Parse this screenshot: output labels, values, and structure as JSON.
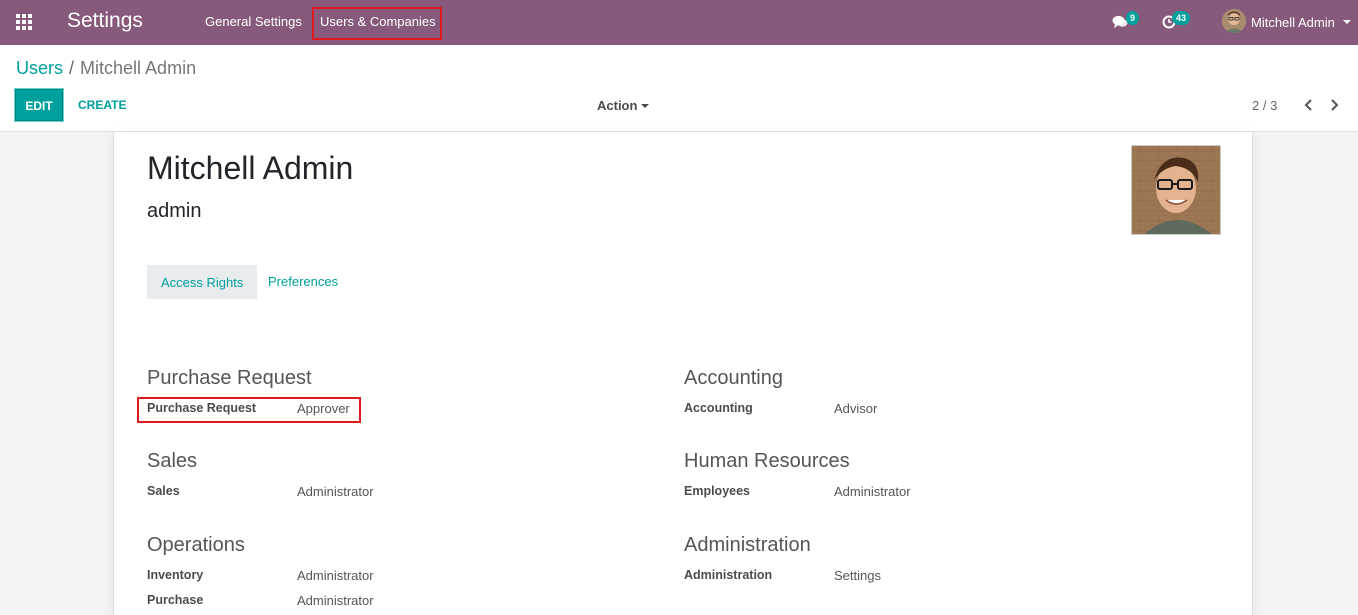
{
  "navbar": {
    "app_title": "Settings",
    "menu": [
      "General Settings",
      "Users & Companies"
    ],
    "messages_count": "9",
    "activities_count": "43",
    "user_name": "Mitchell Admin",
    "bg_color": "#875a7b",
    "badge_color": "#00a09d"
  },
  "breadcrumb": {
    "parent": "Users",
    "separator": "/",
    "current": "Mitchell Admin"
  },
  "toolbar": {
    "edit_label": "EDIT",
    "create_label": "CREATE",
    "action_label": "Action",
    "pager": "2 / 3"
  },
  "form": {
    "name": "Mitchell Admin",
    "login": "admin",
    "tabs": [
      "Access Rights",
      "Preferences"
    ],
    "left_sections": [
      {
        "title": "Purchase Request",
        "fields": [
          {
            "label": "Purchase Request",
            "value": "Approver"
          }
        ]
      },
      {
        "title": "Sales",
        "fields": [
          {
            "label": "Sales",
            "value": "Administrator"
          }
        ]
      },
      {
        "title": "Operations",
        "fields": [
          {
            "label": "Inventory",
            "value": "Administrator"
          },
          {
            "label": "Purchase",
            "value": "Administrator"
          }
        ]
      }
    ],
    "right_sections": [
      {
        "title": "Accounting",
        "fields": [
          {
            "label": "Accounting",
            "value": "Advisor"
          }
        ]
      },
      {
        "title": "Human Resources",
        "fields": [
          {
            "label": "Employees",
            "value": "Administrator"
          }
        ]
      },
      {
        "title": "Administration",
        "fields": [
          {
            "label": "Administration",
            "value": "Settings"
          }
        ]
      }
    ]
  },
  "accent_color": "#00a09d",
  "highlight_color": "#e0191f"
}
